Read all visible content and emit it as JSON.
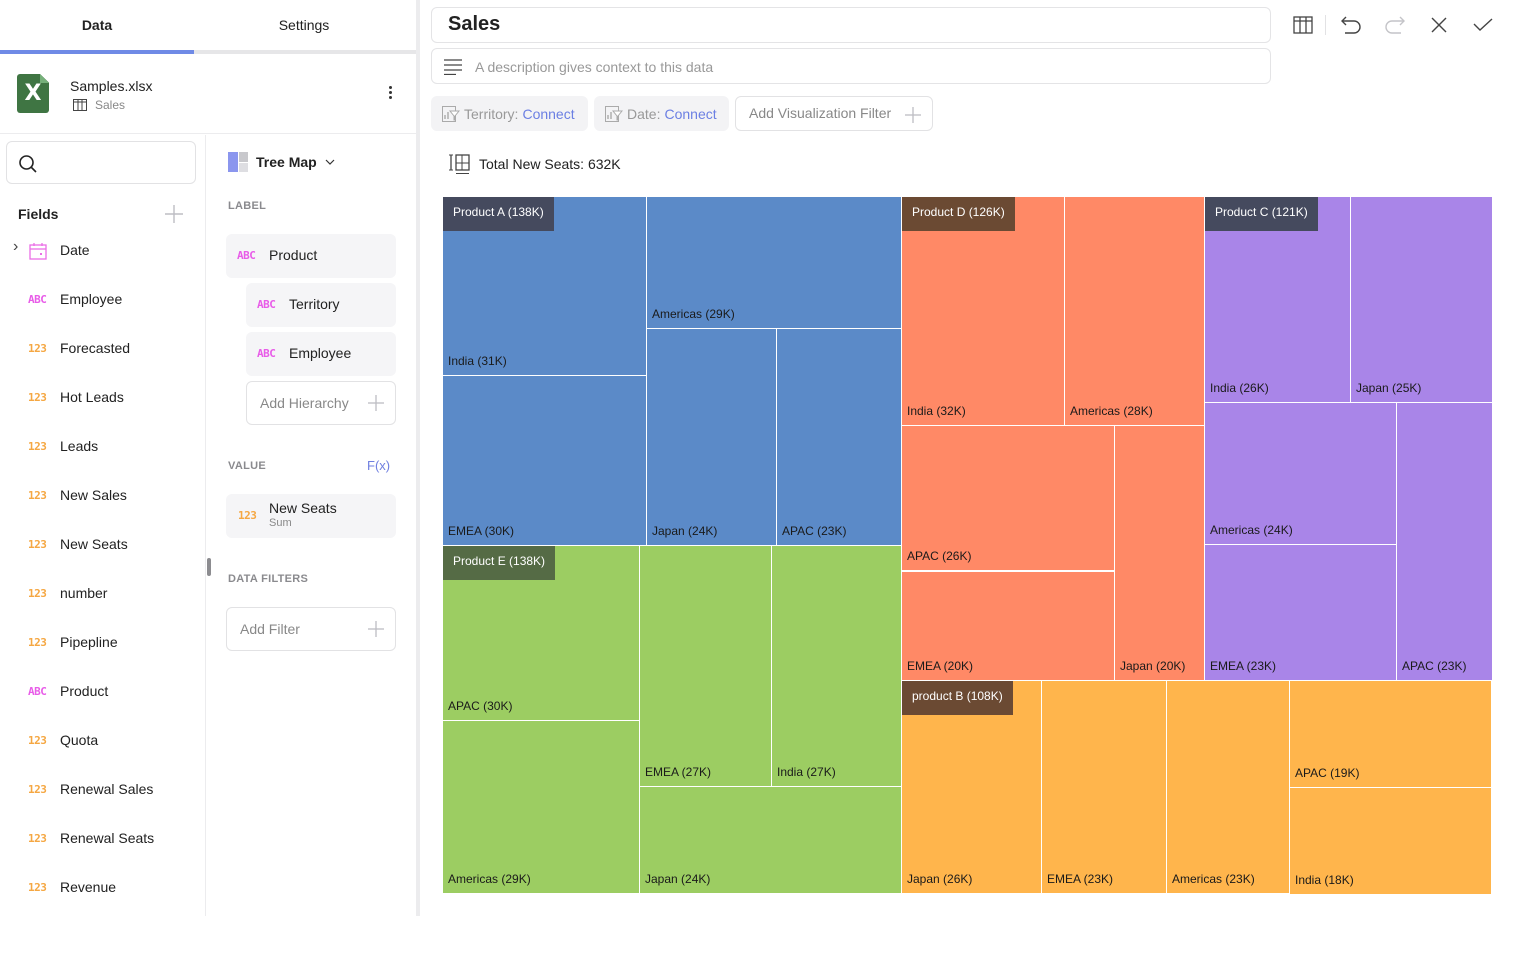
{
  "left_panel": {
    "tabs": [
      {
        "label": "Data",
        "active": true
      },
      {
        "label": "Settings",
        "active": false
      }
    ],
    "source": {
      "file_name": "Samples.xlsx",
      "sheet_name": "Sales",
      "file_icon": "excel-icon",
      "file_icon_letter": "X"
    },
    "search": {
      "placeholder": "",
      "value": ""
    },
    "fields_title": "Fields",
    "fields": [
      {
        "type": "date",
        "type_label": "",
        "name": "Date",
        "expandable": true
      },
      {
        "type": "text",
        "type_label": "ABC",
        "name": "Employee"
      },
      {
        "type": "number",
        "type_label": "123",
        "name": "Forecasted"
      },
      {
        "type": "number",
        "type_label": "123",
        "name": "Hot Leads"
      },
      {
        "type": "number",
        "type_label": "123",
        "name": "Leads"
      },
      {
        "type": "number",
        "type_label": "123",
        "name": "New Sales"
      },
      {
        "type": "number",
        "type_label": "123",
        "name": "New Seats"
      },
      {
        "type": "number",
        "type_label": "123",
        "name": "number"
      },
      {
        "type": "number",
        "type_label": "123",
        "name": "Pipepline"
      },
      {
        "type": "text",
        "type_label": "ABC",
        "name": "Product"
      },
      {
        "type": "number",
        "type_label": "123",
        "name": "Quota"
      },
      {
        "type": "number",
        "type_label": "123",
        "name": "Renewal Sales"
      },
      {
        "type": "number",
        "type_label": "123",
        "name": "Renewal Seats"
      },
      {
        "type": "number",
        "type_label": "123",
        "name": "Revenue"
      }
    ],
    "config": {
      "visualization": "Tree Map",
      "label_section": "LABEL",
      "labels": [
        {
          "type_label": "ABC",
          "name": "Product"
        },
        {
          "type_label": "ABC",
          "name": "Territory"
        },
        {
          "type_label": "ABC",
          "name": "Employee"
        }
      ],
      "add_hierarchy": "Add Hierarchy",
      "value_section": "VALUE",
      "fx_label": "F(x)",
      "value": {
        "type_label": "123",
        "name": "New Seats",
        "aggregation": "Sum"
      },
      "data_filters_section": "DATA FILTERS",
      "add_filter": "Add Filter"
    }
  },
  "header": {
    "title": "Sales",
    "description_placeholder": "A description gives context to this data",
    "toolbar": [
      "table-view",
      "undo",
      "redo",
      "close",
      "confirm"
    ]
  },
  "filters": [
    {
      "field": "Territory:",
      "action": "Connect"
    },
    {
      "field": "Date:",
      "action": "Connect"
    }
  ],
  "add_visualization_filter": "Add Visualization Filter",
  "summary": "Total New Seats: 632K",
  "colors": {
    "accent": "#6f8ae6",
    "link": "#6b7fe3",
    "text_type": "#e85ce8",
    "number_type": "#f5a742"
  },
  "chart_data": {
    "type": "treemap",
    "title": "Total New Seats: 632K",
    "value_unit": "K",
    "groups": [
      {
        "name": "Product A",
        "total": 138,
        "color": "#5b8ac8",
        "tag_color": "#454a5e",
        "children": [
          {
            "name": "India",
            "value": 31
          },
          {
            "name": "EMEA",
            "value": 30
          },
          {
            "name": "Americas",
            "value": 29
          },
          {
            "name": "Japan",
            "value": 24
          },
          {
            "name": "APAC",
            "value": 23
          }
        ]
      },
      {
        "name": "Product E",
        "total": 138,
        "color": "#9ccd62",
        "tag_color": "#556b45",
        "children": [
          {
            "name": "APAC",
            "value": 30
          },
          {
            "name": "Americas",
            "value": 29
          },
          {
            "name": "EMEA",
            "value": 27
          },
          {
            "name": "India",
            "value": 27
          },
          {
            "name": "Japan",
            "value": 24
          }
        ]
      },
      {
        "name": "Product D",
        "total": 126,
        "color": "#ff8966",
        "tag_color": "#6b4a33",
        "children": [
          {
            "name": "India",
            "value": 32
          },
          {
            "name": "Americas",
            "value": 28
          },
          {
            "name": "APAC",
            "value": 26
          },
          {
            "name": "EMEA",
            "value": 20
          },
          {
            "name": "Japan",
            "value": 20
          }
        ]
      },
      {
        "name": "product B",
        "total": 108,
        "color": "#ffb54c",
        "tag_color": "#6b4a33",
        "children": [
          {
            "name": "Japan",
            "value": 26
          },
          {
            "name": "EMEA",
            "value": 23
          },
          {
            "name": "Americas",
            "value": 23
          },
          {
            "name": "APAC",
            "value": 19
          },
          {
            "name": "India",
            "value": 18
          }
        ]
      },
      {
        "name": "Product C",
        "total": 121,
        "color": "#a985e8",
        "tag_color": "#454a5e",
        "children": [
          {
            "name": "India",
            "value": 26
          },
          {
            "name": "Japan",
            "value": 25
          },
          {
            "name": "Americas",
            "value": 24
          },
          {
            "name": "EMEA",
            "value": 23
          },
          {
            "name": "APAC",
            "value": 23
          }
        ]
      }
    ]
  }
}
